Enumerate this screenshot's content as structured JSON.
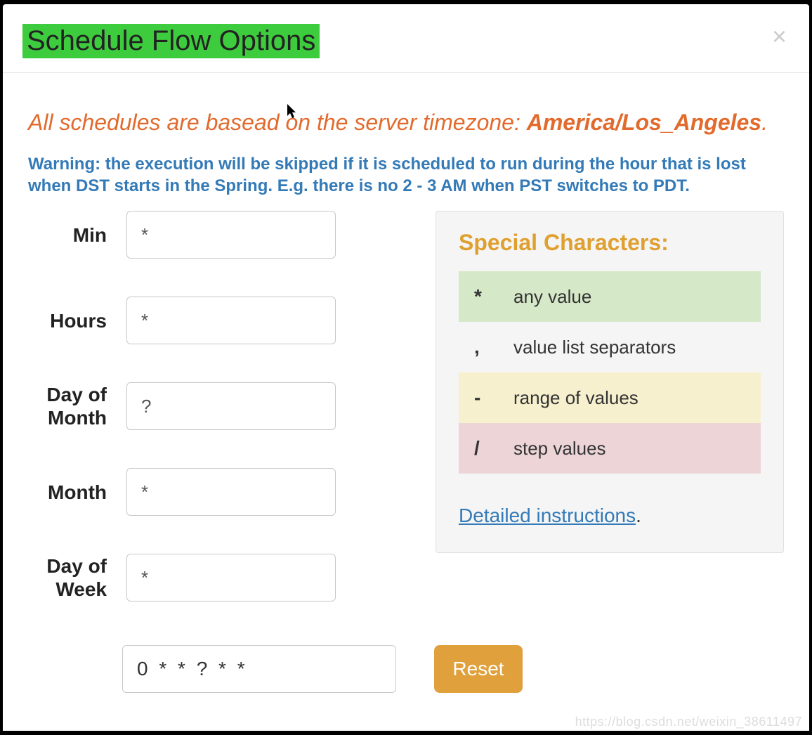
{
  "header": {
    "title": "Schedule Flow Options",
    "close_glyph": "×"
  },
  "timezone_message": {
    "prefix": "All schedules are basead on the server timezone: ",
    "tz": "America/Los_Angeles",
    "suffix": "."
  },
  "warning_text": "Warning: the execution will be skipped if it is scheduled to run during the hour that is lost when DST starts in the Spring. E.g. there is no 2 - 3 AM when PST switches to PDT.",
  "fields": {
    "min": {
      "label": "Min",
      "value": "*"
    },
    "hours": {
      "label": "Hours",
      "value": "*"
    },
    "dom": {
      "label": "Day of Month",
      "value": "?"
    },
    "month": {
      "label": "Month",
      "value": "*"
    },
    "dow": {
      "label": "Day of Week",
      "value": "*"
    }
  },
  "special": {
    "title": "Special Characters:",
    "rows": [
      {
        "sym": "*",
        "desc": "any value"
      },
      {
        "sym": ",",
        "desc": "value list separators"
      },
      {
        "sym": "-",
        "desc": "range of values"
      },
      {
        "sym": "/",
        "desc": "step values"
      }
    ],
    "link_text": "Detailed instructions",
    "link_dot": "."
  },
  "cron": {
    "expression": "0 * * ? * *",
    "reset_label": "Reset"
  },
  "watermark": "https://blog.csdn.net/weixin_38611497"
}
